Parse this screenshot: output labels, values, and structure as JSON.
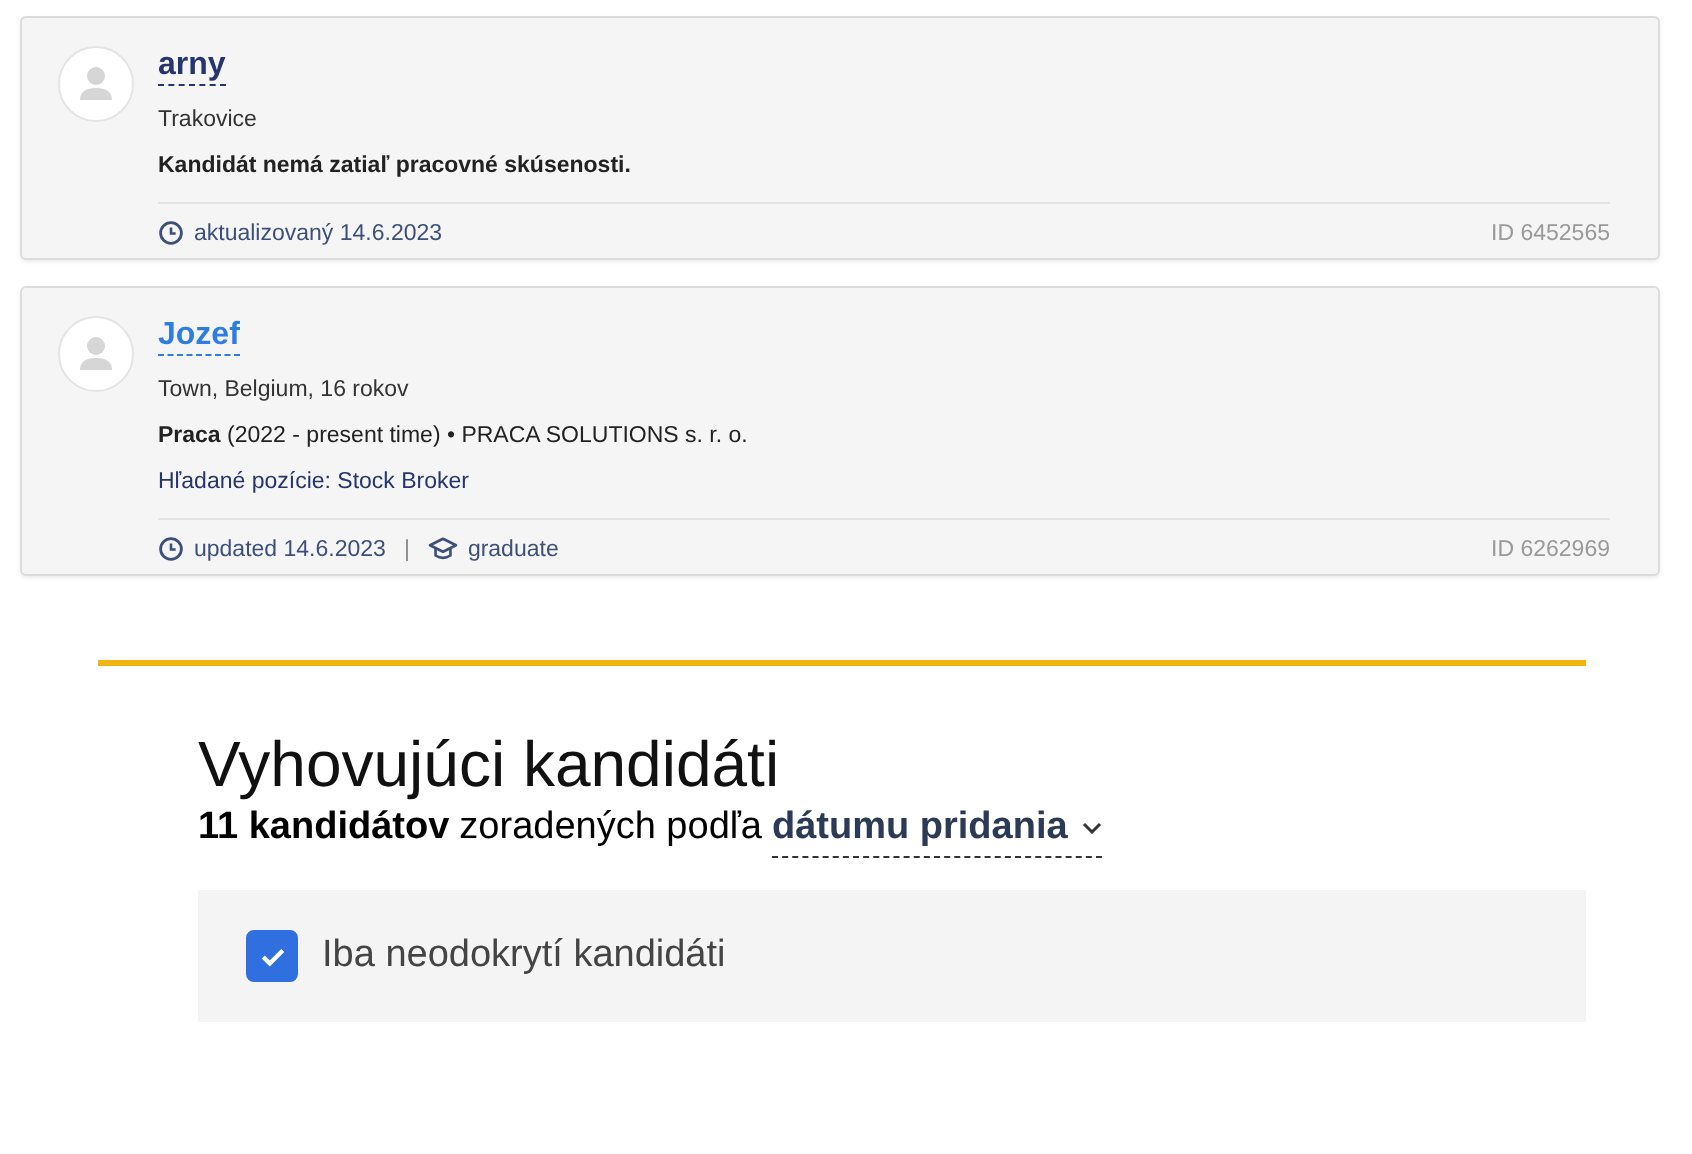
{
  "candidates": [
    {
      "name": "arny",
      "visited": true,
      "location": "Trakovice",
      "details": [
        {
          "kind": "note",
          "text": "Kandidát nemá zatiaľ pracovné skúsenosti."
        }
      ],
      "meta": [
        {
          "kind": "updated",
          "text": "aktualizovaný 14.6.2023"
        }
      ],
      "id": "ID 6452565"
    },
    {
      "name": "Jozef",
      "visited": false,
      "location": "Town, Belgium, 16 rokov",
      "details": [
        {
          "kind": "experience",
          "text": "**Praca** (2022 - present time) • PRACA SOLUTIONS s. r. o."
        },
        {
          "kind": "positions",
          "text": "Hľadané pozície: Stock Broker"
        }
      ],
      "meta": [
        {
          "kind": "updated",
          "text": "updated 14.6.2023"
        },
        {
          "kind": "separator",
          "text": "|"
        },
        {
          "kind": "education",
          "text": "graduate"
        }
      ],
      "id": "ID 6262969"
    }
  ],
  "section": {
    "title": "Vyhovujúci kandidáti",
    "count": "11 kandidátov",
    "sorted_by": "zoradených podľa",
    "sort": "dátumu pridania",
    "filter": {
      "label": "Iba neodokrytí kandidáti",
      "checked": true
    }
  }
}
